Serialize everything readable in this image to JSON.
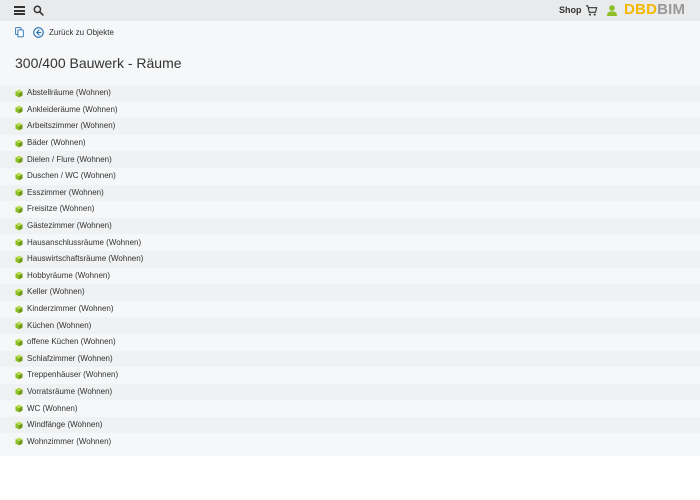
{
  "header": {
    "menu_icon": "hamburger-menu-icon",
    "search_icon": "search-icon",
    "shop_label": "Shop",
    "cart_icon": "shopping-cart-icon",
    "user_icon": "user-icon",
    "logo_part1": "DBD",
    "logo_part2": "BIM",
    "logo_colors": {
      "primary": "#f5b800",
      "secondary": "#999999"
    }
  },
  "nav": {
    "copy_icon": "copy-icon",
    "back_icon": "arrow-left-circle-icon",
    "back_label": "Zurück zu Objekte"
  },
  "page": {
    "title": "300/400 Bauwerk - Räume"
  },
  "rooms": {
    "icon": "cube-icon",
    "icon_color": "#8cbf26",
    "items": [
      {
        "label": "Abstellräume (Wohnen)"
      },
      {
        "label": "Ankleideräume (Wohnen)"
      },
      {
        "label": "Arbeitszimmer (Wohnen)"
      },
      {
        "label": "Bäder (Wohnen)"
      },
      {
        "label": "Dielen / Flure (Wohnen)"
      },
      {
        "label": "Duschen / WC (Wohnen)"
      },
      {
        "label": "Esszimmer (Wohnen)"
      },
      {
        "label": "Freisitze (Wohnen)"
      },
      {
        "label": "Gästezimmer (Wohnen)"
      },
      {
        "label": "Hausanschlussräume (Wohnen)"
      },
      {
        "label": "Hauswirtschaftsräume (Wohnen)"
      },
      {
        "label": "Hobbyräume (Wohnen)"
      },
      {
        "label": "Keller (Wohnen)"
      },
      {
        "label": "Kinderzimmer (Wohnen)"
      },
      {
        "label": "Küchen (Wohnen)"
      },
      {
        "label": "offene Küchen (Wohnen)"
      },
      {
        "label": "Schlafzimmer (Wohnen)"
      },
      {
        "label": "Treppenhäuser (Wohnen)"
      },
      {
        "label": "Vorratsräume (Wohnen)"
      },
      {
        "label": "WC (Wohnen)"
      },
      {
        "label": "Windfänge (Wohnen)"
      },
      {
        "label": "Wohnzimmer (Wohnen)"
      }
    ]
  }
}
